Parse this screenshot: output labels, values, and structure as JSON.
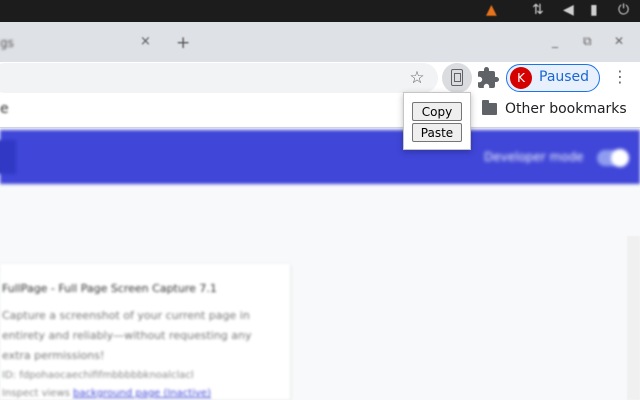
{
  "os_tray": {
    "vlc_icon": "vlc-cone-icon",
    "network_icon": "network-icon",
    "volume_icon": "volume-icon",
    "battery_icon": "battery-icon",
    "power_icon": "power-icon"
  },
  "tab": {
    "title": "gs",
    "close_glyph": "×",
    "new_tab_glyph": "+"
  },
  "window_controls": {
    "minimize": "_",
    "maximize": "⧉",
    "close": "✕"
  },
  "toolbar": {
    "star_glyph": "☆",
    "profile_initial": "K",
    "profile_status": "Paused",
    "menu_glyph": "⋮"
  },
  "bookmarks": {
    "left_fragment": "e",
    "other_label": "Other bookmarks"
  },
  "extensions_page": {
    "developer_mode_label": "Developer mode",
    "developer_mode_on": true,
    "card": {
      "name": "FullPage - Full Page Screen Capture  7.1",
      "description": "Capture a screenshot of your current page in entirety and reliably—without requesting any extra permissions!",
      "id_line": "ID: fdpohaocaechififmbbbbbknoalclacl",
      "inspect_prefix": "Inspect views ",
      "inspect_link": "background page (Inactive)"
    }
  },
  "popup": {
    "copy_label": "Copy",
    "paste_label": "Paste"
  },
  "colors": {
    "header_accent": "#3f46d8",
    "profile_avatar": "#d50000",
    "profile_text": "#1967d2"
  }
}
